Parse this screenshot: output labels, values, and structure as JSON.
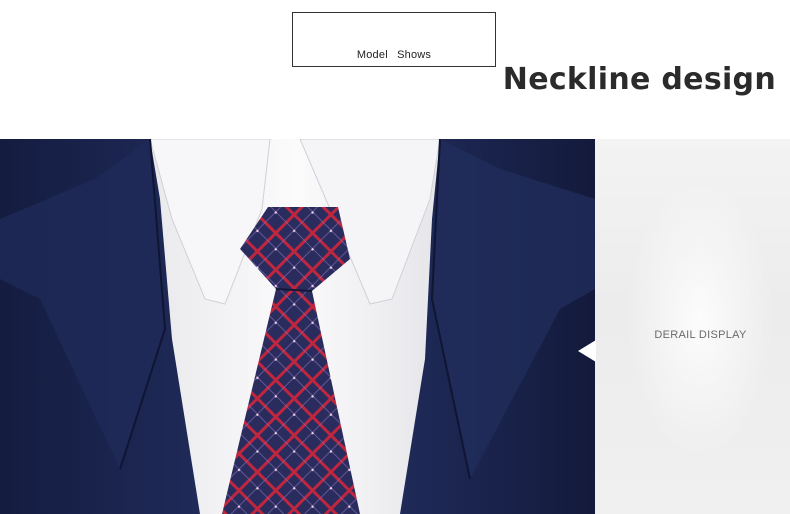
{
  "model_box": {
    "label": "Model  Shows"
  },
  "heading": "Neckline design",
  "side_panel": {
    "label": "DERAIL DISPLAY"
  },
  "colors": {
    "suit": "#1b2550",
    "shirt": "#f4f4f6",
    "tie_base": "#2a2c5e",
    "tie_stripe": "#c0263e",
    "heading": "#2b2b2b"
  }
}
